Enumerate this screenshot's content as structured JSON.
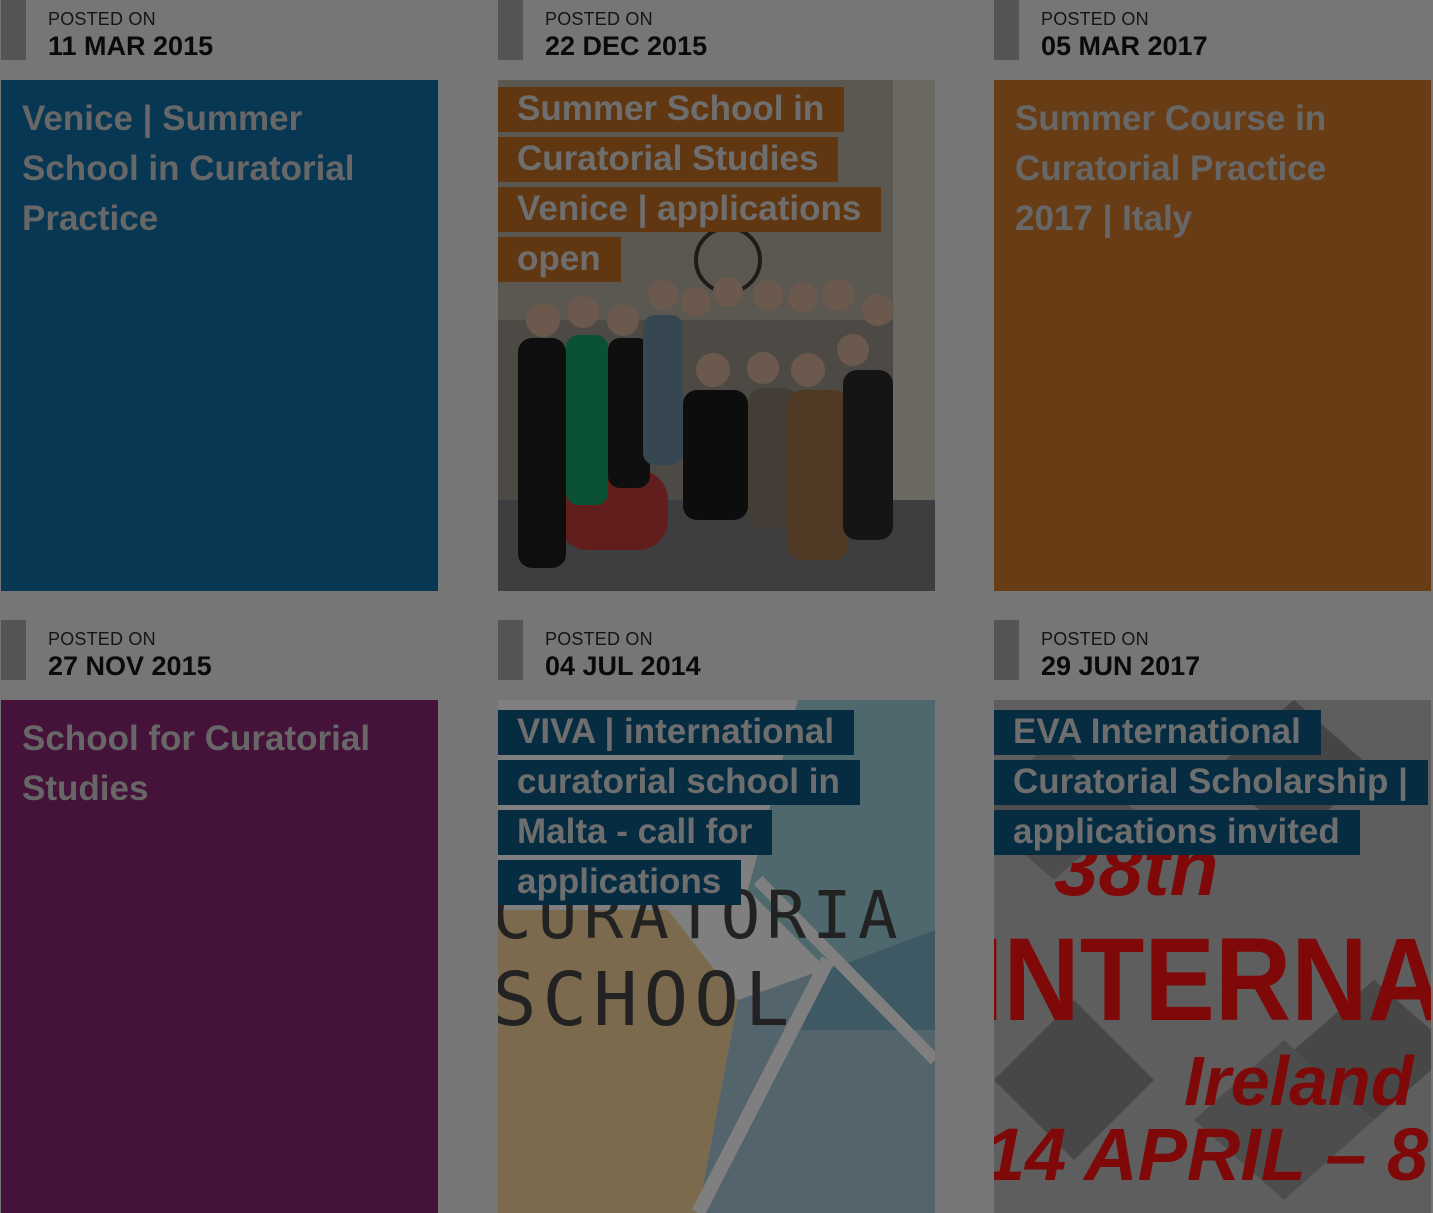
{
  "posts": [
    {
      "posted_label": "POSTED ON",
      "date": "11 MAR 2015",
      "title": "Venice | Summer School in Curatorial Practice",
      "bg": "#0f6fa6"
    },
    {
      "posted_label": "POSTED ON",
      "date": "22 DEC 2015",
      "title": "Summer School in Curatorial Studies Venice | applications open",
      "ribbon": "#c06f23"
    },
    {
      "posted_label": "POSTED ON",
      "date": "05 MAR 2017",
      "title": "Summer Course in Curatorial Practice 2017 | Italy",
      "bg": "#d07a2d"
    },
    {
      "posted_label": "POSTED ON",
      "date": "27 NOV 2015",
      "title": "School for Curatorial Studies",
      "bg": "#8a2472"
    },
    {
      "posted_label": "POSTED ON",
      "date": "04 JUL 2014",
      "title": "VIVA | international curatorial school in Malta - call for applications",
      "ribbon": "#0d5885",
      "image_text": [
        "CURATORIA",
        "SCHOOL"
      ]
    },
    {
      "posted_label": "POSTED ON",
      "date": "29 JUN 2017",
      "title": "EVA International Curatorial Scholarship | applications invited",
      "ribbon": "#0d5885",
      "image_text": [
        "38th",
        "INTERNA",
        "Ireland",
        "14 APRIL – 8"
      ]
    }
  ],
  "overlay_color": "rgba(0,0,0,0.5)"
}
